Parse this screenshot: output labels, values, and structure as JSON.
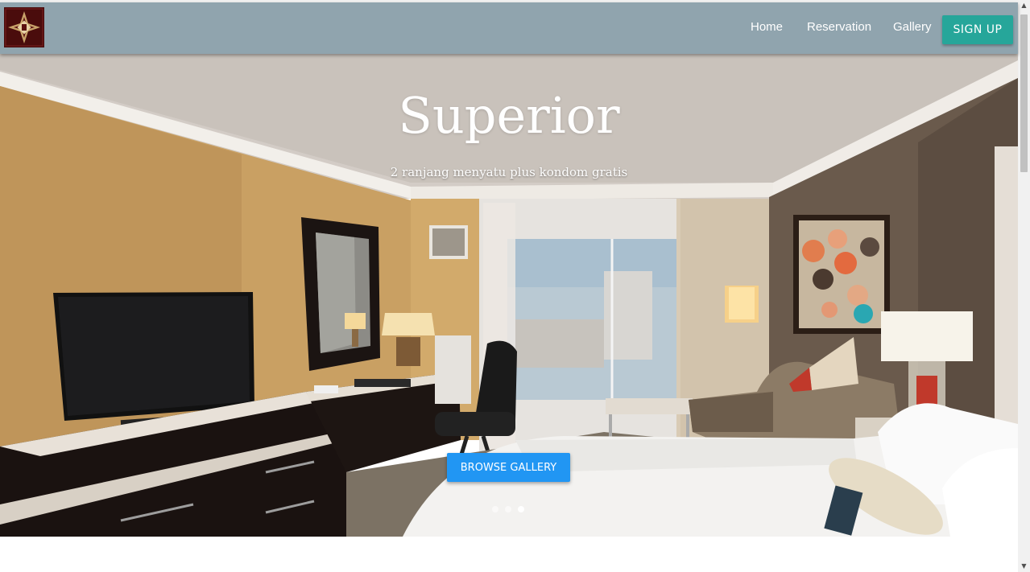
{
  "nav": {
    "logo_alt": "hotel-emblem",
    "links": [
      {
        "label": "Home"
      },
      {
        "label": "Reservation"
      },
      {
        "label": "Gallery"
      }
    ],
    "signup_label": "SIGN UP"
  },
  "hero": {
    "title": "Superior",
    "subtitle": "2 ranjang menyatu plus kondom gratis",
    "button_label": "BROWSE GALLERY",
    "slides_count": 3,
    "active_slide": 3
  },
  "colors": {
    "navbar": "#90a4ae",
    "signup": "#26a69a",
    "browse": "#2196f3"
  }
}
